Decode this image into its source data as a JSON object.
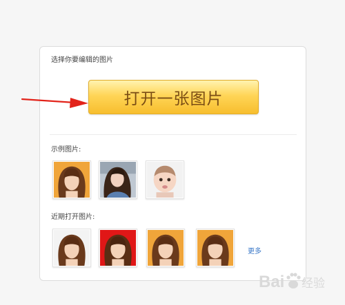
{
  "panel": {
    "select_label": "选择你要编辑的图片",
    "open_button_label": "打开一张图片",
    "examples_label": "示例图片:",
    "recent_label": "近期打开图片:",
    "more_link": "更多"
  },
  "examples": [
    {
      "icon": "photo-woman-bangs-orange-bg",
      "bg": "#f0a53a"
    },
    {
      "icon": "photo-girl-outdoor",
      "bg": "#bfc8d2"
    },
    {
      "icon": "photo-baby",
      "bg": "#f2f2f2"
    }
  ],
  "recent": [
    {
      "icon": "photo-woman-bangs-white-bg",
      "bg": "#f3f3f3"
    },
    {
      "icon": "photo-woman-bangs-red-bg",
      "bg": "#e01717"
    },
    {
      "icon": "photo-woman-bangs-orange-bg",
      "bg": "#f0a53a"
    },
    {
      "icon": "photo-woman-bangs-orange-bg",
      "bg": "#f0a53a"
    }
  ],
  "watermark": {
    "text": "Bai 经验",
    "color": "#d9d9d9"
  },
  "colors": {
    "button_top": "#fff3b0",
    "button_bottom": "#f7be2e",
    "button_text": "#7a4d14",
    "arrow": "#e2231a",
    "link": "#3a78c8"
  }
}
